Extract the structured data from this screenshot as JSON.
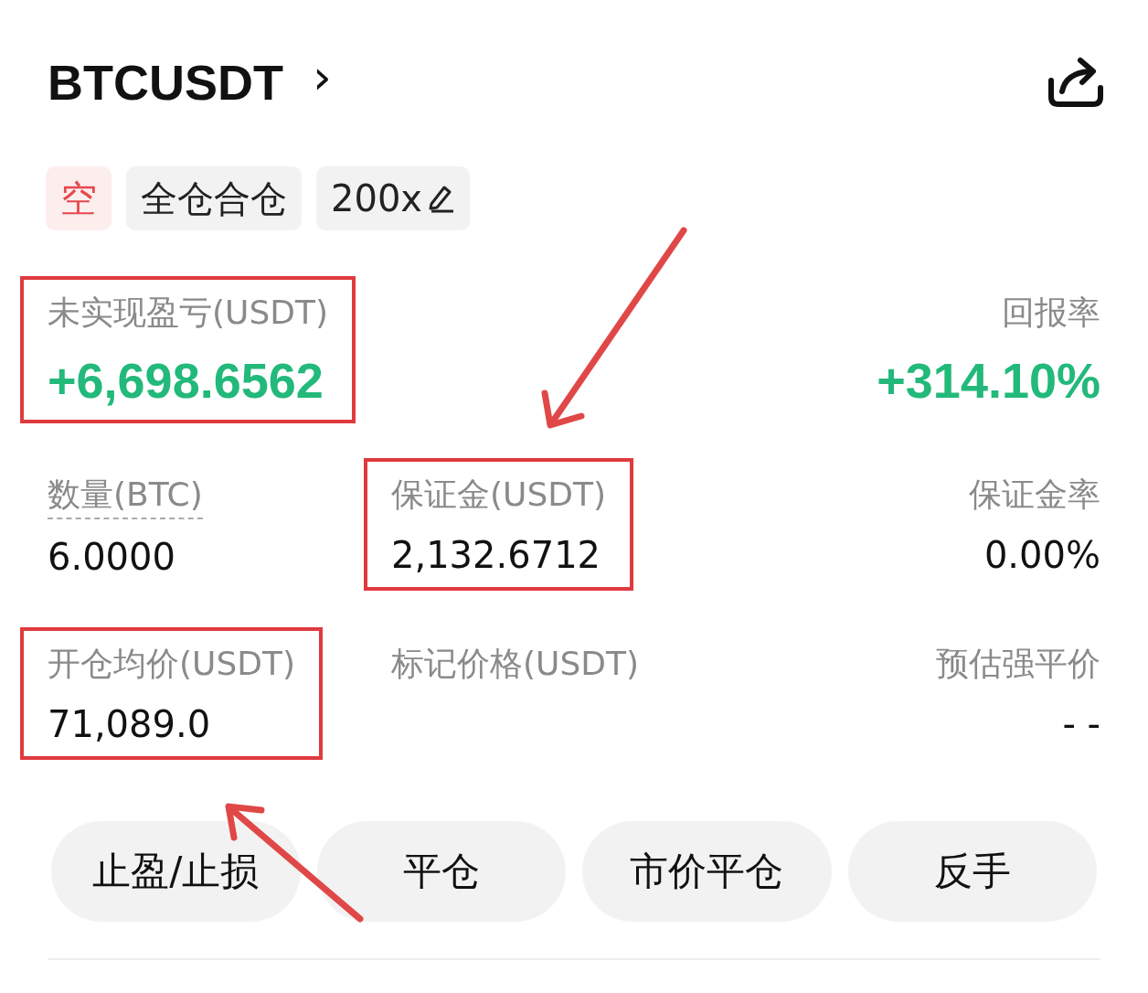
{
  "header": {
    "symbol": "BTCUSDT",
    "chevron": "›"
  },
  "tags": [
    {
      "text": "空",
      "kind": "side"
    },
    {
      "text": "全仓合仓",
      "kind": "plain"
    },
    {
      "text": "200x",
      "kind": "leverage"
    }
  ],
  "stats": [
    [
      {
        "label": "未实现盈亏(USDT)",
        "value": "+6,698.6562",
        "kind": "profit",
        "highlighted": true,
        "dashed": false
      },
      {
        "label": "回报率",
        "value": "+314.10%",
        "kind": "profit",
        "highlighted": false,
        "dashed": false
      }
    ],
    [
      {
        "label": "数量(BTC)",
        "value": "6.0000",
        "kind": "plain",
        "highlighted": false,
        "dashed": true
      },
      {
        "label": "保证金(USDT)",
        "value": "2,132.6712",
        "kind": "plain",
        "highlighted": true,
        "dashed": false
      },
      {
        "label": "保证金率",
        "value": "0.00%",
        "kind": "plain",
        "highlighted": false,
        "dashed": false
      }
    ],
    [
      {
        "label": "开仓均价(USDT)",
        "value": "71,089.0",
        "kind": "plain",
        "highlighted": true,
        "dashed": false
      },
      {
        "label": "标记价格(USDT)",
        "highlighted": false,
        "dashed": false
      },
      {
        "label": "预估强平价",
        "value": "- -",
        "kind": "plain",
        "highlighted": false,
        "dashed": false
      }
    ]
  ],
  "buttons": [
    "止盈/止损",
    "平仓",
    "市价平仓",
    "反手"
  ]
}
